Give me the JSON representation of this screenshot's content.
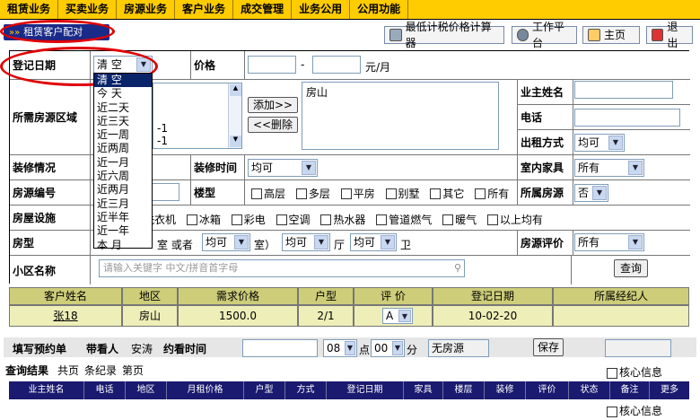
{
  "nav": [
    "租赁业务",
    "买卖业务",
    "房源业务",
    "客户业务",
    "成交管理",
    "业务公用",
    "公用功能"
  ],
  "breadcrumb": {
    "arrow": "»»",
    "label": "租赁客户配对"
  },
  "toolbar": {
    "calc": "最低计税价格计算器",
    "workbench": "工作平台",
    "home": "主页",
    "logout": "退出"
  },
  "form": {
    "reg_date_label": "登记日期",
    "reg_date_value": "清  空",
    "reg_date_options": [
      "清  空",
      "今  天",
      "近二天",
      "近三天",
      "近一周",
      "近两周",
      "近一月",
      "近六周",
      "近两月",
      "近三月",
      "近半年",
      "近一年",
      "本  月"
    ],
    "price_label": "价格",
    "price_sep": "-",
    "price_unit": "元/月",
    "area_label": "所需房源区域",
    "area_list_items": [
      "-1",
      "-1"
    ],
    "add_button": "添加>>",
    "del_button": "<<删除",
    "selected_area": "房山",
    "owner_label": "业主姓名",
    "phone_label": "电话",
    "rent_type_label": "出租方式",
    "rent_type_value": "均可",
    "decor_label": "装修情况",
    "decor_time_label": "装修时间",
    "decor_time_value": "均可",
    "furniture_label": "室内家具",
    "furniture_value": "所有",
    "house_no_label": "房源编号",
    "building_label": "楼型",
    "building_options": [
      "高层",
      "多层",
      "平房",
      "别墅",
      "其它",
      "所有"
    ],
    "own_source_label": "所属房源",
    "own_source_value": "否",
    "facility_label": "房屋设施",
    "facility_options": [
      "洗衣机",
      "冰箱",
      "彩电",
      "空调",
      "热水器",
      "管道燃气",
      "暖气",
      "以上均有"
    ],
    "layout_label": "房型",
    "layout_shi": "室 或者",
    "layout_v1": "均可",
    "layout_shi2": "室）",
    "layout_v2": "均可",
    "layout_ting": "厅",
    "layout_v3": "均可",
    "layout_wei": "卫",
    "rating_label": "房源评价",
    "rating_value": "所有",
    "community_label": "小区名称",
    "community_placeholder": "请输入关键字 中文/拼音首字母",
    "search_button": "查询"
  },
  "results": {
    "headers": [
      "客户姓名",
      "地区",
      "需求价格",
      "户型",
      "评  价",
      "登记日期",
      "所属经纪人"
    ],
    "rows": [
      [
        "张18",
        "房山",
        "1500.0",
        "2/1",
        "A",
        "10-02-20",
        ""
      ]
    ]
  },
  "bottom": {
    "reservation_label": "填写预约单",
    "viewer_label": "带看人",
    "viewer_name": "安涛",
    "appt_label": "约看时间",
    "hour": "08",
    "hour_unit": "点",
    "minute": "00",
    "minute_unit": "分",
    "status": "无房源",
    "save_button": "保存"
  },
  "query": {
    "title": "查询结果",
    "pages": "共页",
    "records": "条纪录",
    "page": "第页",
    "core_info": "核心信息",
    "columns": [
      "业主姓名",
      "电话",
      "地区",
      "月租价格",
      "户型",
      "方式",
      "登记日期",
      "家具",
      "楼层",
      "装修",
      "评价",
      "状态",
      "备注",
      "更多"
    ]
  }
}
